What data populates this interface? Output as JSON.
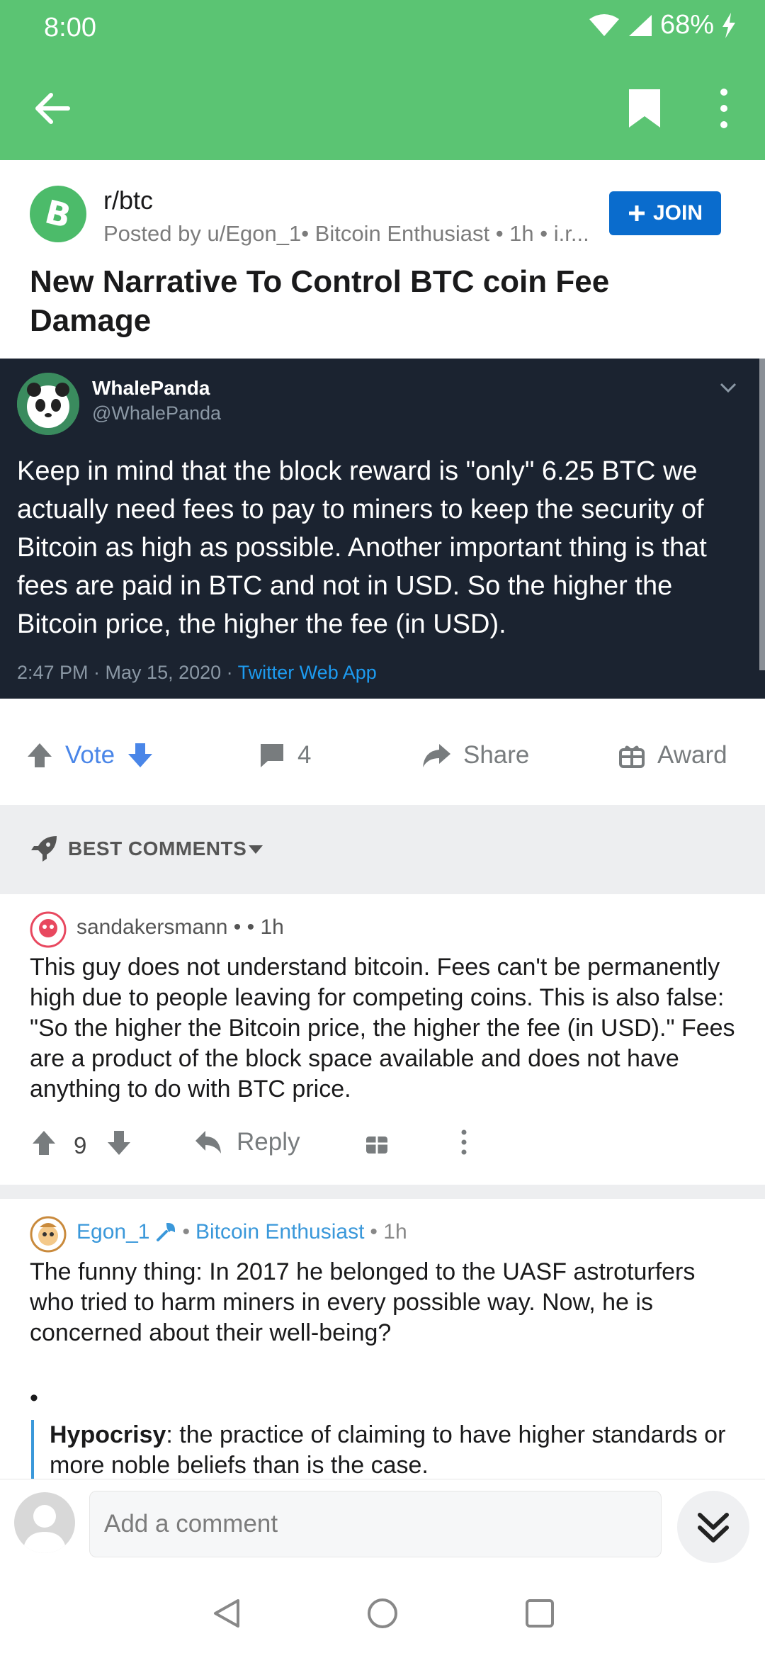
{
  "status_bar": {
    "time": "8:00",
    "battery": "68%"
  },
  "post": {
    "subreddit": "r/btc",
    "posted_line": "Posted by u/Egon_1• Bitcoin Enthusiast • 1h • i.r...",
    "join_label": "JOIN",
    "title": "New Narrative To Control BTC coin Fee Damage"
  },
  "tweet": {
    "name": "WhalePanda",
    "handle": "@WhalePanda",
    "text": "Keep in mind that the block reward is \"only\" 6.25 BTC we actually need fees to pay to miners to keep the security of Bitcoin as high as possible. Another important thing is that fees are paid in BTC and not in USD. So the higher the Bitcoin price, the higher the fee (in USD).",
    "meta": "2:47 PM · May 15, 2020 · ",
    "app": "Twitter Web App"
  },
  "actions": {
    "vote_label": "Vote",
    "comments_count": "4",
    "share_label": "Share",
    "award_label": "Award"
  },
  "comments_header": {
    "label": "BEST COMMENTS"
  },
  "comments": [
    {
      "user": "sandakersmann •  • 1h",
      "body": "This guy does not understand bitcoin. Fees can't be permanently high due to people leaving for competing coins. This is also false: \"So the higher the Bitcoin price, the higher the fee (in USD).\" Fees are a product of the block space available and does not have anything to do with BTC price.",
      "score": "9",
      "reply_label": "Reply"
    },
    {
      "user": "Egon_1",
      "flair": "Bitcoin Enthusiast",
      "time": "• 1h",
      "sep": "•",
      "body": "The funny thing: In 2017 he belonged to the UASF astroturfers who tried to harm miners in every possible way. Now, he is concerned about their well-being?",
      "bullet": "•",
      "quote_term": "Hypocrisy",
      "quote_rest": ": the practice of claiming to have higher standards or more noble beliefs than is the case."
    }
  ],
  "composer": {
    "placeholder": "Add a comment"
  },
  "colors": {
    "header_green": "#5bc473",
    "join_blue": "#0a6ccd",
    "tweet_bg": "#1b2330",
    "link_blue": "#3a98da"
  },
  "icons": [
    "back-arrow-icon",
    "bookmark-icon",
    "more-vert-icon",
    "bitcoin-icon",
    "upvote-icon",
    "downvote-icon",
    "comment-icon",
    "share-icon",
    "gift-icon",
    "rocket-icon",
    "caret-down-icon",
    "reply-icon",
    "wrench-icon",
    "collapse-icon",
    "nav-back-icon",
    "nav-home-icon",
    "nav-recents-icon"
  ]
}
